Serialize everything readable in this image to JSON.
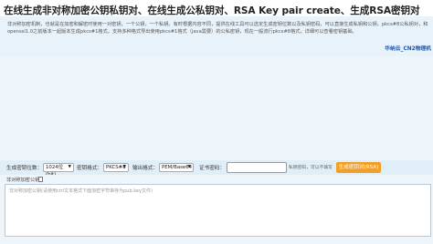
{
  "page_title": "在线生成非对称加密公钥私钥对、在线生成公私钥对、RSA Key pair create、生成RSA密钥对",
  "description": {
    "text": "非对称加密机制，也就是在加密和解密时使用一对密钥，一个公钥，一个私钥。有时根据内容不同，提供在线工具可以选定生成密钥位数以及私钥密码，可以直接生成私钥和公钥，pkcs#8公私钥对，和openssl1.0之前版本一起版本生成pkcs#1格式，支持多种格式导出使用pkcs#1格式（java需要）的公私密钥，现在一般流行pkcs#8格式，详细可以查看密钥基础。",
    "link": "华纳云_CN2物理机"
  },
  "controls": {
    "keysize_label": "生成密钥位数：",
    "keysize_value": "1024位(bit)",
    "format_label": "密钥格式：",
    "format_value": "PKCS#8",
    "output_label": "输出格式：",
    "output_value": "PEM/Base64",
    "password_label": "证书密码：",
    "password_value": "",
    "password_hint": "私钥密码，可以不填写",
    "generate_button": "生成密钥对(RSA)"
  },
  "public_key": {
    "label": "非对称加密公钥",
    "placeholder": "非对称加密公钥(请使用ctrl文本格式下面加密字符串存为pub.key文件)"
  },
  "icons": {
    "copy": "copy-icon",
    "dropdown": "chevron-down-icon"
  },
  "colors": {
    "button": "#f0a02a",
    "link": "#1a55b0",
    "panel_bg": "#e8f2fa"
  }
}
